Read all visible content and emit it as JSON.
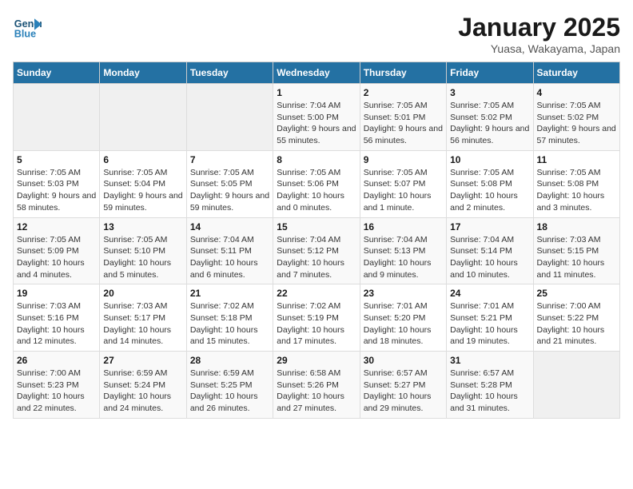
{
  "header": {
    "logo_line1": "General",
    "logo_line2": "Blue",
    "title": "January 2025",
    "subtitle": "Yuasa, Wakayama, Japan"
  },
  "days_of_week": [
    "Sunday",
    "Monday",
    "Tuesday",
    "Wednesday",
    "Thursday",
    "Friday",
    "Saturday"
  ],
  "weeks": [
    [
      {
        "day": "",
        "info": ""
      },
      {
        "day": "",
        "info": ""
      },
      {
        "day": "",
        "info": ""
      },
      {
        "day": "1",
        "info": "Sunrise: 7:04 AM\nSunset: 5:00 PM\nDaylight: 9 hours and 55 minutes."
      },
      {
        "day": "2",
        "info": "Sunrise: 7:05 AM\nSunset: 5:01 PM\nDaylight: 9 hours and 56 minutes."
      },
      {
        "day": "3",
        "info": "Sunrise: 7:05 AM\nSunset: 5:02 PM\nDaylight: 9 hours and 56 minutes."
      },
      {
        "day": "4",
        "info": "Sunrise: 7:05 AM\nSunset: 5:02 PM\nDaylight: 9 hours and 57 minutes."
      }
    ],
    [
      {
        "day": "5",
        "info": "Sunrise: 7:05 AM\nSunset: 5:03 PM\nDaylight: 9 hours and 58 minutes."
      },
      {
        "day": "6",
        "info": "Sunrise: 7:05 AM\nSunset: 5:04 PM\nDaylight: 9 hours and 59 minutes."
      },
      {
        "day": "7",
        "info": "Sunrise: 7:05 AM\nSunset: 5:05 PM\nDaylight: 9 hours and 59 minutes."
      },
      {
        "day": "8",
        "info": "Sunrise: 7:05 AM\nSunset: 5:06 PM\nDaylight: 10 hours and 0 minutes."
      },
      {
        "day": "9",
        "info": "Sunrise: 7:05 AM\nSunset: 5:07 PM\nDaylight: 10 hours and 1 minute."
      },
      {
        "day": "10",
        "info": "Sunrise: 7:05 AM\nSunset: 5:08 PM\nDaylight: 10 hours and 2 minutes."
      },
      {
        "day": "11",
        "info": "Sunrise: 7:05 AM\nSunset: 5:08 PM\nDaylight: 10 hours and 3 minutes."
      }
    ],
    [
      {
        "day": "12",
        "info": "Sunrise: 7:05 AM\nSunset: 5:09 PM\nDaylight: 10 hours and 4 minutes."
      },
      {
        "day": "13",
        "info": "Sunrise: 7:05 AM\nSunset: 5:10 PM\nDaylight: 10 hours and 5 minutes."
      },
      {
        "day": "14",
        "info": "Sunrise: 7:04 AM\nSunset: 5:11 PM\nDaylight: 10 hours and 6 minutes."
      },
      {
        "day": "15",
        "info": "Sunrise: 7:04 AM\nSunset: 5:12 PM\nDaylight: 10 hours and 7 minutes."
      },
      {
        "day": "16",
        "info": "Sunrise: 7:04 AM\nSunset: 5:13 PM\nDaylight: 10 hours and 9 minutes."
      },
      {
        "day": "17",
        "info": "Sunrise: 7:04 AM\nSunset: 5:14 PM\nDaylight: 10 hours and 10 minutes."
      },
      {
        "day": "18",
        "info": "Sunrise: 7:03 AM\nSunset: 5:15 PM\nDaylight: 10 hours and 11 minutes."
      }
    ],
    [
      {
        "day": "19",
        "info": "Sunrise: 7:03 AM\nSunset: 5:16 PM\nDaylight: 10 hours and 12 minutes."
      },
      {
        "day": "20",
        "info": "Sunrise: 7:03 AM\nSunset: 5:17 PM\nDaylight: 10 hours and 14 minutes."
      },
      {
        "day": "21",
        "info": "Sunrise: 7:02 AM\nSunset: 5:18 PM\nDaylight: 10 hours and 15 minutes."
      },
      {
        "day": "22",
        "info": "Sunrise: 7:02 AM\nSunset: 5:19 PM\nDaylight: 10 hours and 17 minutes."
      },
      {
        "day": "23",
        "info": "Sunrise: 7:01 AM\nSunset: 5:20 PM\nDaylight: 10 hours and 18 minutes."
      },
      {
        "day": "24",
        "info": "Sunrise: 7:01 AM\nSunset: 5:21 PM\nDaylight: 10 hours and 19 minutes."
      },
      {
        "day": "25",
        "info": "Sunrise: 7:00 AM\nSunset: 5:22 PM\nDaylight: 10 hours and 21 minutes."
      }
    ],
    [
      {
        "day": "26",
        "info": "Sunrise: 7:00 AM\nSunset: 5:23 PM\nDaylight: 10 hours and 22 minutes."
      },
      {
        "day": "27",
        "info": "Sunrise: 6:59 AM\nSunset: 5:24 PM\nDaylight: 10 hours and 24 minutes."
      },
      {
        "day": "28",
        "info": "Sunrise: 6:59 AM\nSunset: 5:25 PM\nDaylight: 10 hours and 26 minutes."
      },
      {
        "day": "29",
        "info": "Sunrise: 6:58 AM\nSunset: 5:26 PM\nDaylight: 10 hours and 27 minutes."
      },
      {
        "day": "30",
        "info": "Sunrise: 6:57 AM\nSunset: 5:27 PM\nDaylight: 10 hours and 29 minutes."
      },
      {
        "day": "31",
        "info": "Sunrise: 6:57 AM\nSunset: 5:28 PM\nDaylight: 10 hours and 31 minutes."
      },
      {
        "day": "",
        "info": ""
      }
    ]
  ]
}
